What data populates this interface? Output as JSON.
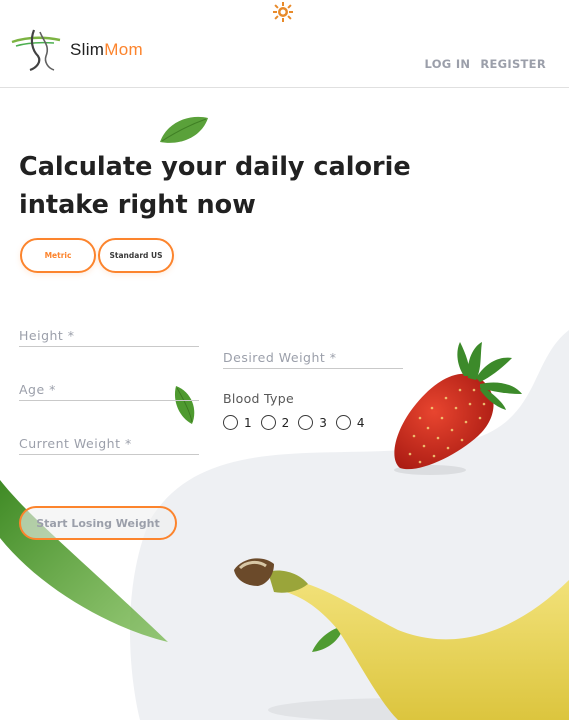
{
  "header": {
    "logo": {
      "slim": "Slim",
      "mom": "Mom"
    },
    "nav": {
      "login": "LOG IN",
      "register": "REGISTER"
    },
    "theme_icon": "sun-icon"
  },
  "main": {
    "title": "Calculate your daily calorie intake right now",
    "units": {
      "metric": "Metric",
      "standard": "Standard US",
      "selected": "Metric"
    },
    "form": {
      "height_placeholder": "Height *",
      "age_placeholder": "Age *",
      "current_weight_placeholder": "Current Weight *",
      "desired_weight_placeholder": "Desired Weight *",
      "blood_type_label": "Blood Type",
      "blood_types": [
        "1",
        "2",
        "3",
        "4"
      ],
      "submit_label": "Start Losing Weight"
    }
  },
  "colors": {
    "accent": "#fc842d",
    "text": "#212121",
    "muted": "#9b9faa",
    "blob": "#f0f1f3"
  },
  "decorations": [
    "leaf-icon",
    "strawberry-icon",
    "banana-icon"
  ]
}
